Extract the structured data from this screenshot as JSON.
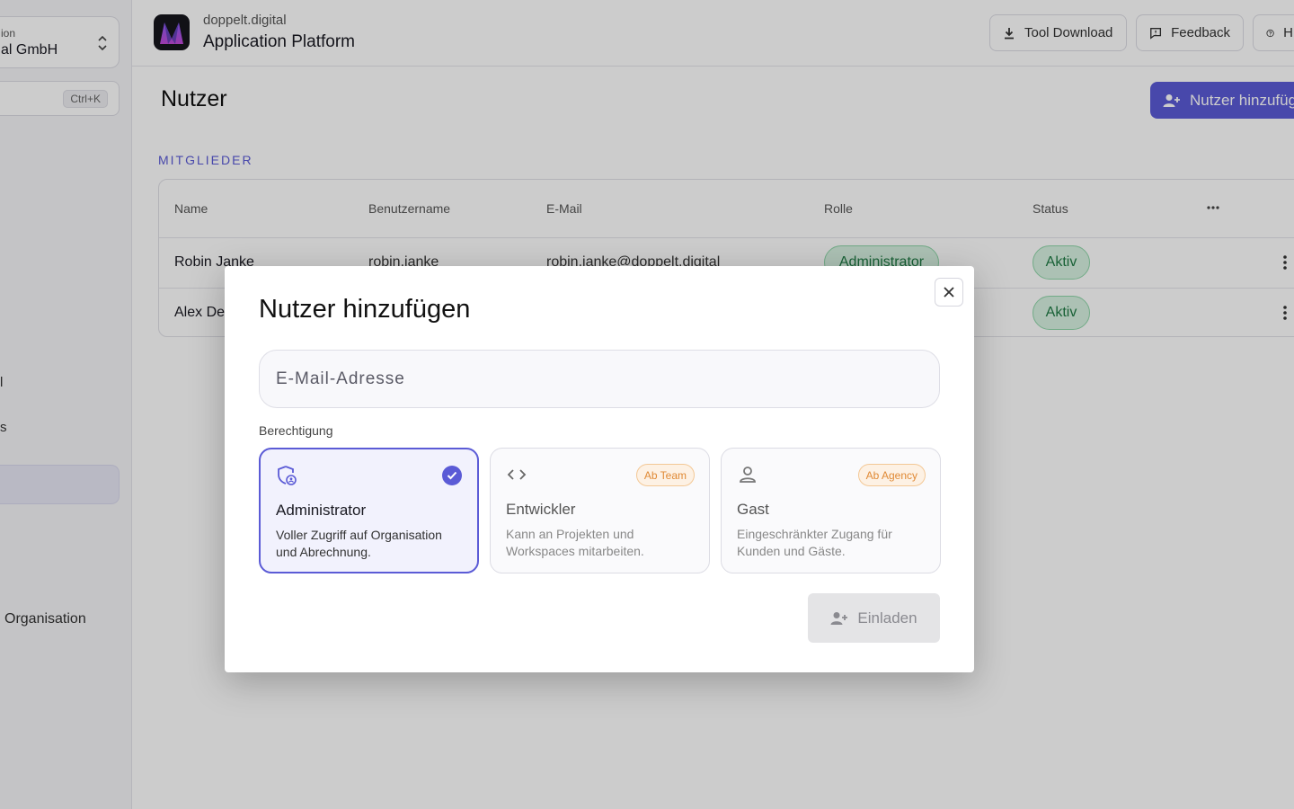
{
  "sidebar": {
    "org_small": "ion",
    "org_name": "al GmbH",
    "search_shortcut": "Ctrl+K",
    "nav_fragment_1": "l",
    "nav_fragment_2": "s",
    "nav_org": "Organisation"
  },
  "topbar": {
    "brand_small": "doppelt.digital",
    "brand_title": "Application Platform",
    "tool_download": "Tool Download",
    "feedback": "Feedback",
    "help": "H"
  },
  "page": {
    "title": "Nutzer",
    "add_user": "Nutzer hinzufüg",
    "section": "MITGLIEDER"
  },
  "table": {
    "headers": [
      "Name",
      "Benutzername",
      "E-Mail",
      "Rolle",
      "Status"
    ],
    "rows": [
      {
        "name": "Robin Janke",
        "username": "robin.janke",
        "email": "robin.janke@doppelt.digital",
        "role": "Administrator",
        "status": "Aktiv"
      },
      {
        "name": "Alex De",
        "status": "Aktiv"
      }
    ]
  },
  "modal": {
    "title": "Nutzer hinzufügen",
    "email_placeholder": "E-Mail-Adresse",
    "permission_label": "Berechtigung",
    "roles": [
      {
        "title": "Administrator",
        "desc": "Voller Zugriff auf Organisation und Abrechnung.",
        "icon": "shield-user-icon",
        "selected": true
      },
      {
        "title": "Entwickler",
        "desc": "Kann an Projekten und Workspaces mitarbeiten.",
        "icon": "code-icon",
        "badge": "Ab Team"
      },
      {
        "title": "Gast",
        "desc": "Eingeschränkter Zugang für Kunden und Gäste.",
        "icon": "user-icon",
        "badge": "Ab Agency"
      }
    ],
    "invite": "Einladen"
  },
  "colors": {
    "accent": "#5b5bd6",
    "success": "#1e7a44",
    "badge_orange": "#e08a36"
  }
}
